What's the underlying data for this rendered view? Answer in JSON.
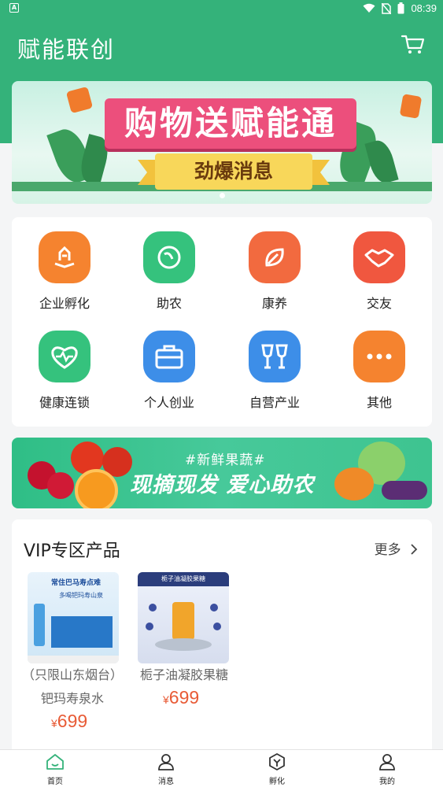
{
  "statusbar": {
    "time": "08:39",
    "left_badge": "A"
  },
  "header": {
    "title": "赋能联创",
    "cart_icon": "cart-icon"
  },
  "banner": {
    "title": "购物送赋能通",
    "subtitle": "劲爆消息"
  },
  "grid": {
    "items": [
      {
        "label": "企业孵化",
        "icon": "incubate-icon",
        "color": "#f5832f"
      },
      {
        "label": "助农",
        "icon": "leaf-circle-icon",
        "color": "#35c27d"
      },
      {
        "label": "康养",
        "icon": "leaf-icon",
        "color": "#f26a3f"
      },
      {
        "label": "交友",
        "icon": "handshake-icon",
        "color": "#f0573f"
      },
      {
        "label": "健康连锁",
        "icon": "heart-pulse-icon",
        "color": "#35c27d"
      },
      {
        "label": "个人创业",
        "icon": "briefcase-icon",
        "color": "#3d8ee8"
      },
      {
        "label": "自营产业",
        "icon": "glasses-icon",
        "color": "#3d8ee8"
      },
      {
        "label": "其他",
        "icon": "more-icon",
        "color": "#f5832f"
      }
    ]
  },
  "promo": {
    "tag": "#新鲜果蔬#",
    "text": "现摘现发 爱心助农"
  },
  "vip": {
    "title": "VIP专区产品",
    "more": "更多",
    "products": [
      {
        "name": "（只限山东烟台）钯玛寿泉水",
        "currency": "¥",
        "price": "699",
        "thumb_text1": "常住巴马寿点难",
        "thumb_text2": "多喝钯玛寿山泉"
      },
      {
        "name": "栀子油凝胶果糖",
        "currency": "¥",
        "price": "699",
        "thumb_text1": "栀子油凝胶果糖"
      }
    ]
  },
  "tabbar": {
    "items": [
      {
        "label": "首页",
        "icon": "home-icon",
        "active": true
      },
      {
        "label": "消息",
        "icon": "user-message-icon",
        "active": false
      },
      {
        "label": "孵化",
        "icon": "incubate-cube-icon",
        "active": false
      },
      {
        "label": "我的",
        "icon": "profile-icon",
        "active": false
      }
    ]
  },
  "colors": {
    "brand_green": "#34b27a",
    "price_red": "#e85b36"
  }
}
